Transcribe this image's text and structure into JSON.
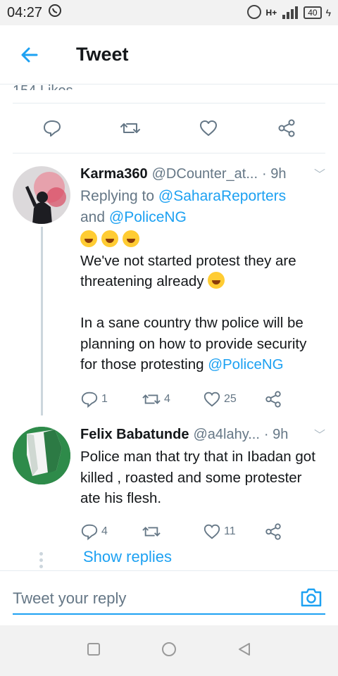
{
  "status": {
    "time": "04:27",
    "network": "H+",
    "battery": "40"
  },
  "header": {
    "title": "Tweet"
  },
  "partial_text": "154 Likes",
  "tweets": [
    {
      "name": "Karma360",
      "handle": "@DCounter_at...",
      "time": "· 9h",
      "reply_prefix": "Replying to ",
      "reply_to_1": "@SaharaReporters",
      "reply_and": "and ",
      "reply_to_2": "@PoliceNG",
      "line1": "We've not started protest they are",
      "line2": "threatening already",
      "para2": "In a sane country thw police will be planning on how to provide security for those protesting",
      "mention": "@PoliceNG",
      "replies": "1",
      "retweets": "4",
      "likes": "25"
    },
    {
      "name": "Felix Babatunde",
      "handle": "@a4lahy...",
      "time": "· 9h",
      "text": "Police man that try that in Ibadan got killed , roasted and some protester ate his flesh.",
      "replies": "4",
      "retweets": "",
      "likes": "11"
    }
  ],
  "show_replies": "Show replies",
  "reply_placeholder": "Tweet your reply",
  "colors": {
    "accent": "#1da1f2",
    "muted": "#657786"
  }
}
